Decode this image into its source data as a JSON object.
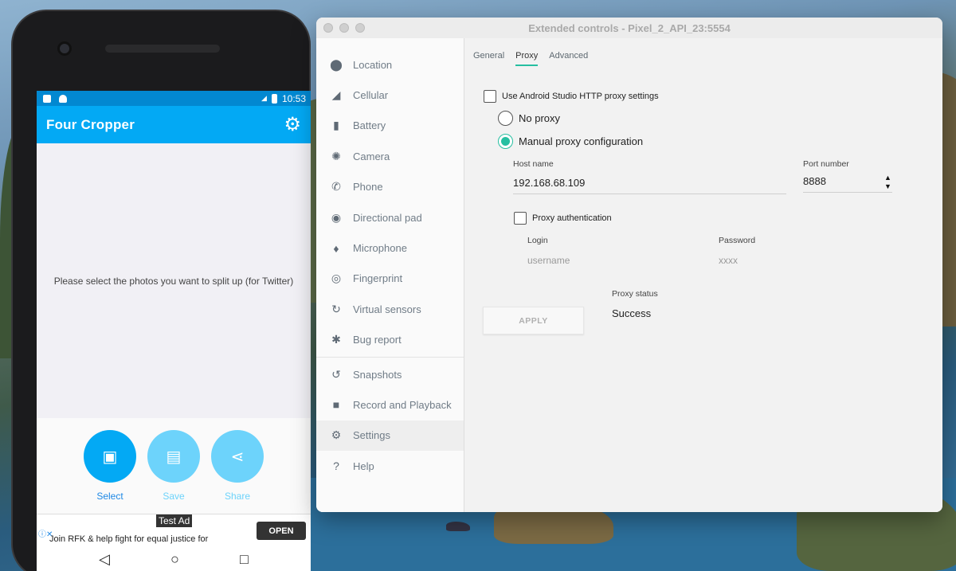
{
  "phone": {
    "status_time": "10:53",
    "app_title": "Four Cropper",
    "message": "Please select the photos you want to split up (for Twitter)",
    "actions": [
      {
        "label": "Select",
        "color": "#03a9f4",
        "label_color": "#1e88e5"
      },
      {
        "label": "Save",
        "color": "#6dd3fb",
        "label_color": "#6dd3fb"
      },
      {
        "label": "Share",
        "color": "#6dd3fb",
        "label_color": "#6dd3fb"
      }
    ],
    "ad": {
      "tag": "Test Ad",
      "text": "Join RFK & help fight for equal justice for",
      "open_label": "OPEN"
    }
  },
  "window": {
    "title": "Extended controls - Pixel_2_API_23:5554",
    "sidebar": [
      {
        "label": "Location",
        "icon": "location-pin-icon"
      },
      {
        "label": "Cellular",
        "icon": "signal-icon"
      },
      {
        "label": "Battery",
        "icon": "battery-icon"
      },
      {
        "label": "Camera",
        "icon": "camera-icon"
      },
      {
        "label": "Phone",
        "icon": "phone-icon"
      },
      {
        "label": "Directional pad",
        "icon": "dpad-icon"
      },
      {
        "label": "Microphone",
        "icon": "microphone-icon"
      },
      {
        "label": "Fingerprint",
        "icon": "fingerprint-icon"
      },
      {
        "label": "Virtual sensors",
        "icon": "rotation-icon"
      },
      {
        "label": "Bug report",
        "icon": "bug-icon"
      },
      {
        "label": "Snapshots",
        "icon": "history-icon"
      },
      {
        "label": "Record and Playback",
        "icon": "video-camera-icon"
      },
      {
        "label": "Settings",
        "icon": "gear-icon"
      },
      {
        "label": "Help",
        "icon": "help-icon"
      }
    ],
    "active_item": "Settings",
    "tabs": [
      "General",
      "Proxy",
      "Advanced"
    ],
    "active_tab": "Proxy",
    "proxy": {
      "use_studio_label": "Use Android Studio HTTP proxy settings",
      "no_proxy_label": "No proxy",
      "manual_label": "Manual proxy configuration",
      "host_label": "Host name",
      "host_value": "192.168.68.109",
      "port_label": "Port number",
      "port_value": "8888",
      "auth_label": "Proxy authentication",
      "login_label": "Login",
      "login_placeholder": "username",
      "password_label": "Password",
      "password_placeholder": "xxxx",
      "apply_label": "APPLY",
      "status_label": "Proxy status",
      "status_value": "Success"
    },
    "accent_color": "#26bfa1"
  }
}
